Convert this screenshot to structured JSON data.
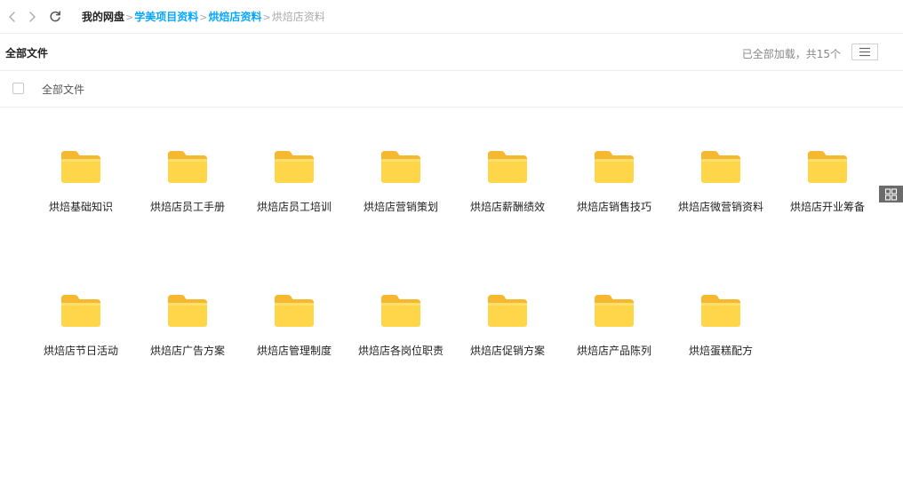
{
  "nav": {
    "back_icon": "chevron-left-icon",
    "forward_icon": "chevron-right-icon",
    "refresh_icon": "refresh-icon"
  },
  "breadcrumb": {
    "root": "我的网盘",
    "links": [
      "学美项目资料",
      "烘焙店资料"
    ],
    "current": "烘焙店资料",
    "separator": ">"
  },
  "toolbar": {
    "title": "全部文件",
    "status": "已全部加载，共15个",
    "list_view_icon": "list-view-icon",
    "grid_view_icon": "grid-view-icon"
  },
  "select_all": {
    "label": "全部文件"
  },
  "colors": {
    "accent": "#06a7ff",
    "folder_body": "#FFD54A",
    "folder_tab": "#F5B82E",
    "active_view": "#6b6b6b"
  },
  "files": [
    {
      "name": "烘焙基础知识",
      "icon": "folder-icon"
    },
    {
      "name": "烘焙店员工手册",
      "icon": "folder-icon"
    },
    {
      "name": "烘焙店员工培训",
      "icon": "folder-icon"
    },
    {
      "name": "烘焙店营销策划",
      "icon": "folder-icon"
    },
    {
      "name": "烘焙店薪酬绩效",
      "icon": "folder-icon"
    },
    {
      "name": "烘焙店销售技巧",
      "icon": "folder-icon"
    },
    {
      "name": "烘焙店微营销资料",
      "icon": "folder-icon"
    },
    {
      "name": "烘焙店开业筹备",
      "icon": "folder-icon"
    },
    {
      "name": "烘焙店节日活动",
      "icon": "folder-icon"
    },
    {
      "name": "烘焙店广告方案",
      "icon": "folder-icon"
    },
    {
      "name": "烘焙店管理制度",
      "icon": "folder-icon"
    },
    {
      "name": "烘焙店各岗位职责",
      "icon": "folder-icon"
    },
    {
      "name": "烘焙店促销方案",
      "icon": "folder-icon"
    },
    {
      "name": "烘焙店产品陈列",
      "icon": "folder-icon"
    },
    {
      "name": "烘焙蛋糕配方",
      "icon": "folder-icon"
    }
  ]
}
